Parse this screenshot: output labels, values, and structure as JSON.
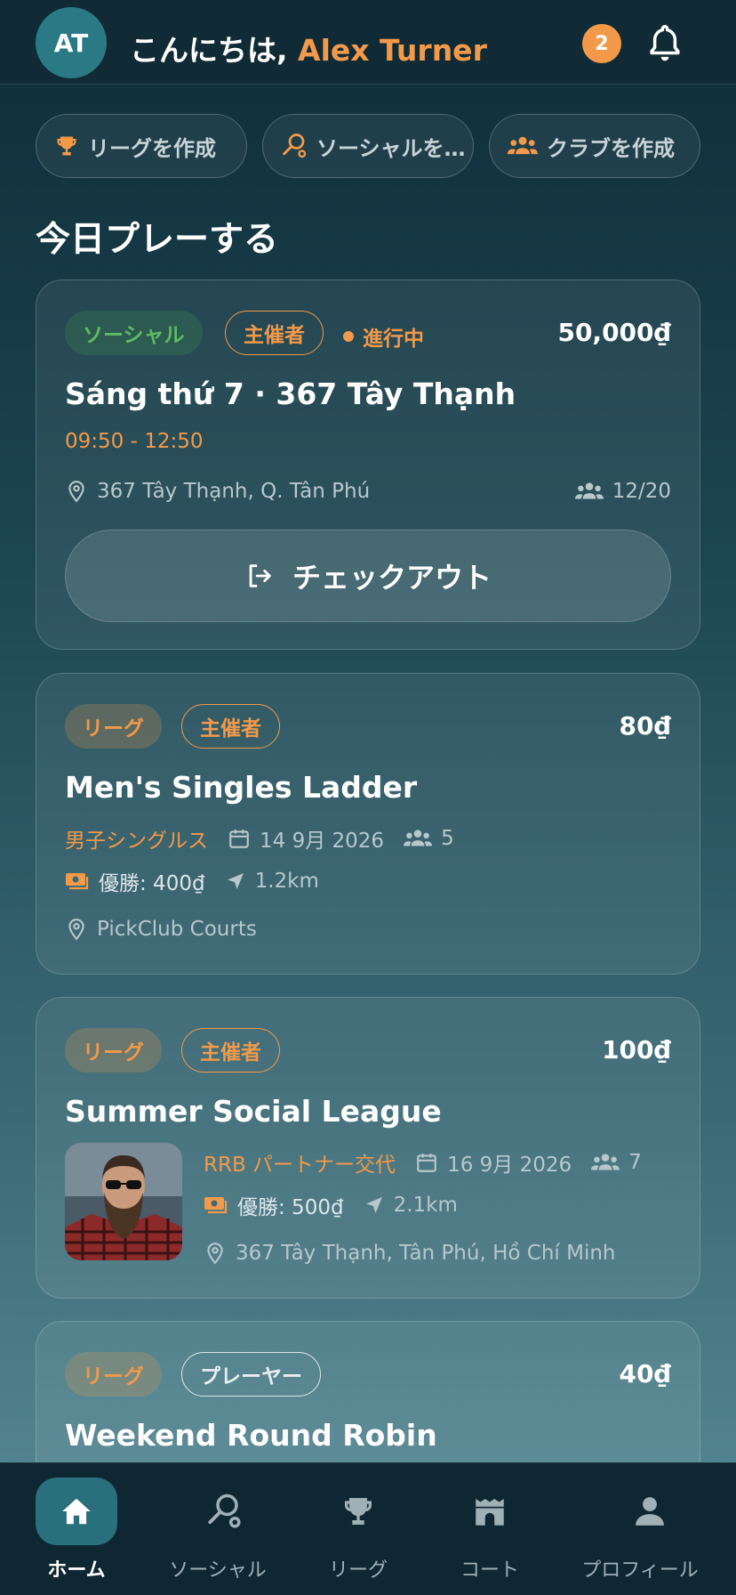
{
  "header": {
    "avatar_initials": "AT",
    "greeting": "こんにちは, ",
    "user_name": "Alex Turner",
    "notification_count": "2"
  },
  "quick_actions": [
    {
      "label": "リーグを作成",
      "icon": "trophy-icon"
    },
    {
      "label": "ソーシャルを…",
      "icon": "social-icon"
    },
    {
      "label": "クラブを作成",
      "icon": "group-icon"
    }
  ],
  "section_title": "今日プレーする",
  "cards": [
    {
      "type_tag": "ソーシャル",
      "role_tag": "主催者",
      "status": "進行中",
      "price": "50,000₫",
      "title": "Sáng thứ 7 · 367 Tây Thạnh",
      "time": "09:50 - 12:50",
      "location": "367 Tây Thạnh, Q. Tân Phú",
      "players": "12/20",
      "action_label": "チェックアウト"
    },
    {
      "type_tag": "リーグ",
      "role_tag": "主催者",
      "price": "80₫",
      "title": "Men's Singles Ladder",
      "format": "男子シングルス",
      "date": "14 9月 2026",
      "players": "5",
      "prize": "優勝: 400₫",
      "distance": "1.2km",
      "location": "PickClub Courts"
    },
    {
      "type_tag": "リーグ",
      "role_tag": "主催者",
      "price": "100₫",
      "title": "Summer Social League",
      "format": "RRB パートナー交代",
      "date": "16 9月 2026",
      "players": "7",
      "prize": "優勝: 500₫",
      "distance": "2.1km",
      "location": "367 Tây Thạnh, Tân Phú, Hồ Chí Minh"
    },
    {
      "type_tag": "リーグ",
      "role_tag": "プレーヤー",
      "price": "40₫",
      "title": "Weekend Round Robin"
    }
  ],
  "bottom_nav": [
    {
      "label": "ホーム",
      "icon": "home-icon",
      "active": true
    },
    {
      "label": "ソーシャル",
      "icon": "social-icon",
      "active": false
    },
    {
      "label": "リーグ",
      "icon": "trophy-icon",
      "active": false
    },
    {
      "label": "コート",
      "icon": "court-icon",
      "active": false
    },
    {
      "label": "プロフィール",
      "icon": "person-icon",
      "active": false
    }
  ],
  "colors": {
    "accent": "#f2994a",
    "social_green": "#5dbb63",
    "nav_bg": "#0f2733"
  }
}
